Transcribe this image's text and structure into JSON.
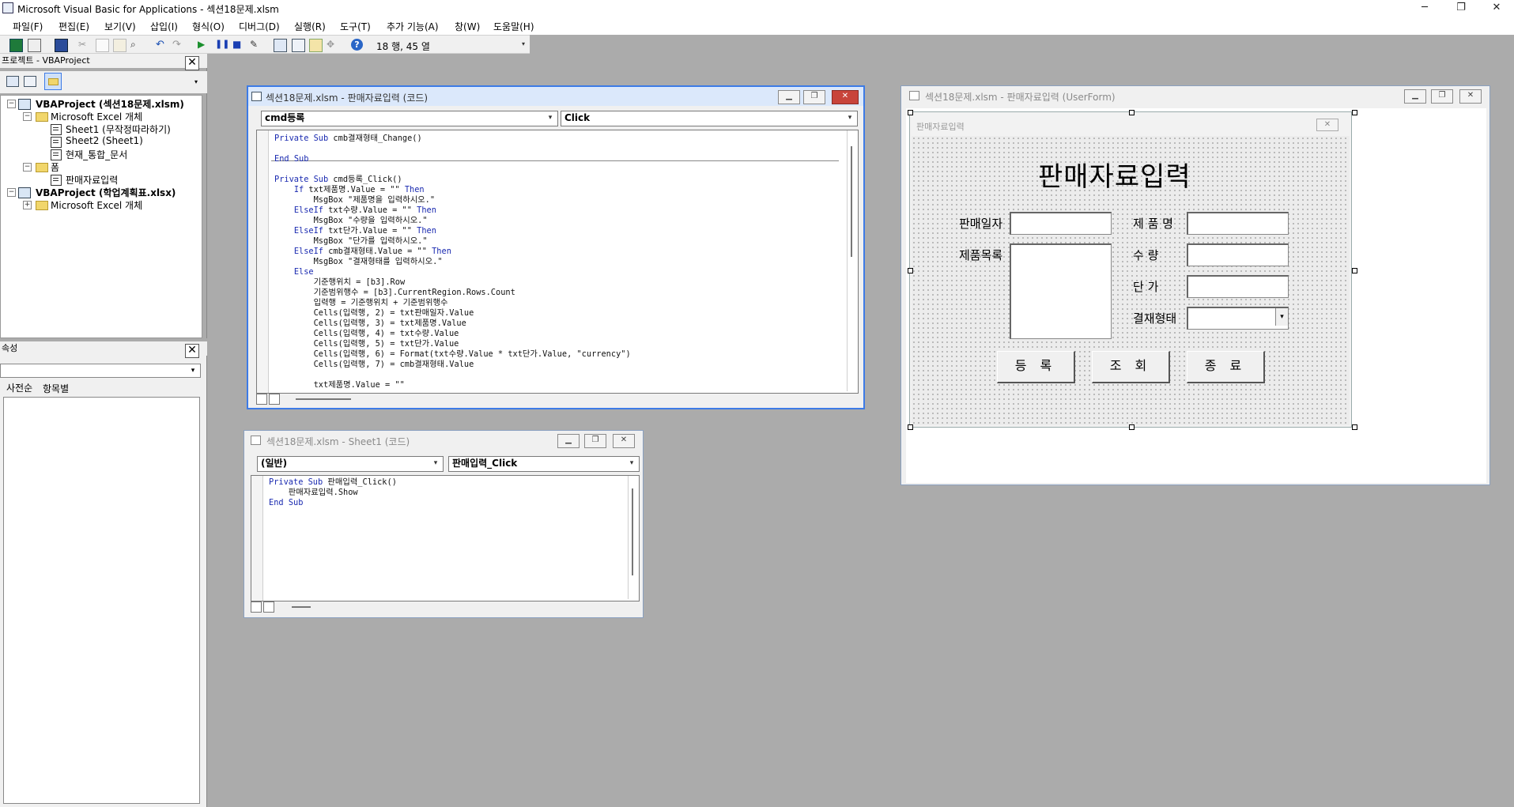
{
  "window": {
    "title": "Microsoft Visual Basic for Applications - 섹션18문제.xlsm",
    "minimize": "─",
    "restore": "❐",
    "close": "✕"
  },
  "menu": [
    "파일(F)",
    "편집(E)",
    "보기(V)",
    "삽입(I)",
    "형식(O)",
    "디버그(D)",
    "실행(R)",
    "도구(T)",
    "추가 기능(A)",
    "창(W)",
    "도움말(H)"
  ],
  "toolbar": {
    "position": "18 행, 45 열",
    "icons": [
      "excel-icon",
      "insert-userform-icon",
      "save-icon",
      "cut-icon",
      "copy-icon",
      "paste-icon",
      "find-icon",
      "undo-icon",
      "redo-icon",
      "run-icon",
      "break-icon",
      "reset-icon",
      "design-mode-icon",
      "project-explorer-icon",
      "properties-icon",
      "object-browser-icon",
      "toolbox-icon",
      "help-icon"
    ]
  },
  "project_pane": {
    "title": "프로젝트 - VBAProject",
    "close": "✕",
    "tree": [
      {
        "label": "VBAProject (섹션18문제.xlsm)",
        "bold": true,
        "box": "−"
      },
      {
        "label": "Microsoft Excel 개체",
        "box": "−"
      },
      {
        "label": "Sheet1 (무작정따라하기)"
      },
      {
        "label": "Sheet2 (Sheet1)"
      },
      {
        "label": "현재_통합_문서"
      },
      {
        "label": "폼",
        "box": "−"
      },
      {
        "label": "판매자료입력"
      },
      {
        "label": "VBAProject (학업계획표.xlsx)",
        "bold": true,
        "box": "−"
      },
      {
        "label": "Microsoft Excel 개체",
        "box": "+"
      }
    ]
  },
  "properties_pane": {
    "title": "속성",
    "close": "✕",
    "tabs": [
      "사전순",
      "항목별"
    ]
  },
  "code_window_main": {
    "title": "섹션18문제.xlsm - 판매자료입력 (코드)",
    "object_combo": "cmd등록",
    "proc_combo": "Click",
    "lines": [
      "Private Sub cmb결재형태_Change()",
      "",
      "End Sub",
      "",
      "Private Sub cmd등록_Click()",
      "    If txt제품명.Value = \"\" Then",
      "        MsgBox \"제품명을 입력하시오.\"",
      "    ElseIf txt수량.Value = \"\" Then",
      "        MsgBox \"수량을 입력하시오.\"",
      "    ElseIf txt단가.Value = \"\" Then",
      "        MsgBox \"단가를 입력하시오.\"",
      "    ElseIf cmb결재형태.Value = \"\" Then",
      "        MsgBox \"결재형태를 입력하시오.\"",
      "    Else",
      "        기준행위치 = [b3].Row",
      "        기준범위행수 = [b3].CurrentRegion.Rows.Count",
      "        입력행 = 기준행위치 + 기준범위행수",
      "        Cells(입력행, 2) = txt판매일자.Value",
      "        Cells(입력행, 3) = txt제품명.Value",
      "        Cells(입력행, 4) = txt수량.Value",
      "        Cells(입력행, 5) = txt단가.Value",
      "        Cells(입력행, 6) = Format(txt수량.Value * txt단가.Value, \"currency\")",
      "        Cells(입력행, 7) = cmb결재형태.Value",
      "",
      "        txt제품명.Value = \"\""
    ]
  },
  "code_window_sheet1": {
    "title": "섹션18문제.xlsm - Sheet1 (코드)",
    "object_combo": "(일반)",
    "proc_combo": "판매입력_Click",
    "lines": [
      "Private Sub 판매입력_Click()",
      "    판매자료입력.Show",
      "End Sub"
    ]
  },
  "userform_window": {
    "title": "섹션18문제.xlsm - 판매자료입력 (UserForm)",
    "form_caption": "판매자료입력",
    "form_close": "✕",
    "heading": "판매자료입력",
    "labels": {
      "date": "판매일자",
      "product_list": "제품목록",
      "product_name": "제 품 명",
      "quantity": "수    량",
      "unit_price": "단    가",
      "payment_type": "결재형태"
    },
    "buttons": [
      "등 록",
      "조 회",
      "종 료"
    ]
  }
}
